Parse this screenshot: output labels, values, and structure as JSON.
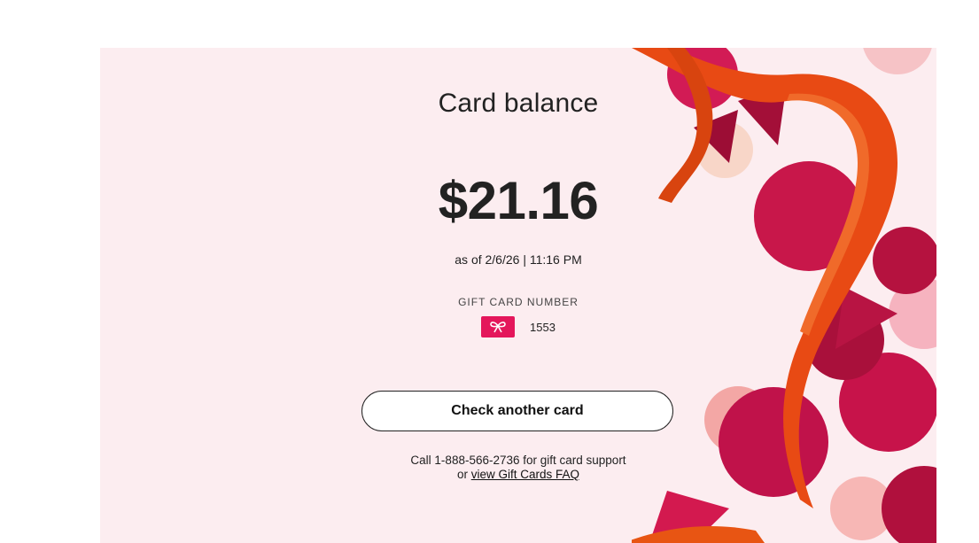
{
  "card": {
    "title": "Card balance",
    "balance": "$21.16",
    "as_of": "as of 2/6/26 | 11:16 PM",
    "number_label": "GIFT CARD NUMBER",
    "number_last4": "1553",
    "badge_icon": "bow-icon",
    "badge_color": "#e4165b"
  },
  "actions": {
    "check_another_label": "Check another card"
  },
  "support": {
    "line1": "Call 1-888-566-2736 for gift card support",
    "line2_prefix": "or ",
    "faq_link": "view Gift Cards FAQ"
  },
  "colors": {
    "panel_background": "#fcedf0",
    "ribbon": "#e84a14",
    "confetti": "#c8174a"
  }
}
